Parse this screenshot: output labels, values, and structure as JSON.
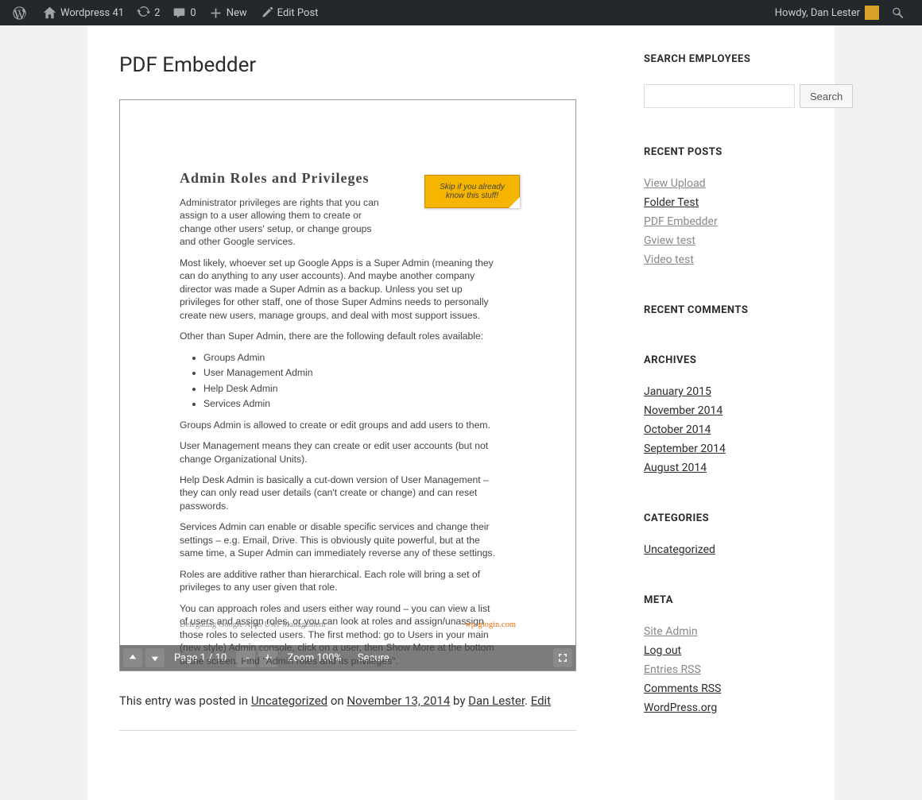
{
  "admin_bar": {
    "site_title": "Wordpress 41",
    "updates": "2",
    "comments": "0",
    "new": "New",
    "edit_post": "Edit Post",
    "howdy": "Howdy, Dan Lester"
  },
  "post": {
    "title": "PDF Embedder",
    "meta": {
      "prefix": "This entry was posted in ",
      "category": "Uncategorized",
      "on": " on ",
      "date": "November 13, 2014",
      "by": " by ",
      "author": "Dan Lester",
      "sep": ". ",
      "edit": "Edit"
    }
  },
  "pdf": {
    "title": "Admin Roles and Privileges",
    "sticky": "Skip if you already know this stuff!",
    "p1": "Administrator privileges are rights that you can assign to a user allowing them to create or change other users' setup, or change groups and other Google services.",
    "p2": "Most likely, whoever set up Google Apps is a Super Admin (meaning they can do anything to any user accounts). And maybe another company director was made a Super Admin as a backup. Unless you set up privileges for other staff, one of those Super Admins needs to personally create new users, manage groups, and deal with most support issues.",
    "p3": "Other than Super Admin, there are the following default roles available:",
    "list": [
      "Groups Admin",
      "User Management Admin",
      "Help Desk Admin",
      "Services Admin"
    ],
    "p4": "Groups Admin is allowed to create or edit groups and add users to them.",
    "p5": "User Management means they can create or edit user accounts (but not change Organizational Units).",
    "p6": "Help Desk Admin is basically a cut-down version of User Management – they can only read user details (can't create or change) and can reset passwords.",
    "p7": "Services Admin can enable or disable specific services and change their settings – e.g. Email, Drive. This is obviously quite powerful, but at the same time, a Super Admin can immediately reverse any of these settings.",
    "p8": "Roles are additive rather than hierarchical. Each role will bring a set of privileges to any user given that role.",
    "p9": "You can approach roles and users either way round – you can view a list of users and assign roles, or you can look at roles and assign/unassign those roles to selected users. The first method: go to Users in your main (new style) Admin console, click on a user, then Show More at the bottom of the screen. Find \"Admin roles and its privileges\".",
    "footer_left": "Delegating Google Apps User Management",
    "footer_right": "wp-glogin.com",
    "toolbar": {
      "page": "Page 1 / 10",
      "zoom": "Zoom 100%",
      "secure": "Secure"
    }
  },
  "sidebar": {
    "search": {
      "title": "SEARCH EMPLOYEES",
      "button": "Search"
    },
    "recent_posts": {
      "title": "RECENT POSTS",
      "items": [
        "View Upload",
        "Folder Test",
        "PDF Embedder",
        "Gview test",
        "Video test"
      ]
    },
    "recent_comments": {
      "title": "RECENT COMMENTS"
    },
    "archives": {
      "title": "ARCHIVES",
      "items": [
        "January 2015",
        "November 2014",
        "October 2014",
        "September 2014",
        "August 2014"
      ]
    },
    "categories": {
      "title": "CATEGORIES",
      "items": [
        "Uncategorized"
      ]
    },
    "meta": {
      "title": "META",
      "items": [
        "Site Admin",
        "Log out",
        "Entries RSS",
        "Comments RSS",
        "WordPress.org"
      ]
    }
  }
}
